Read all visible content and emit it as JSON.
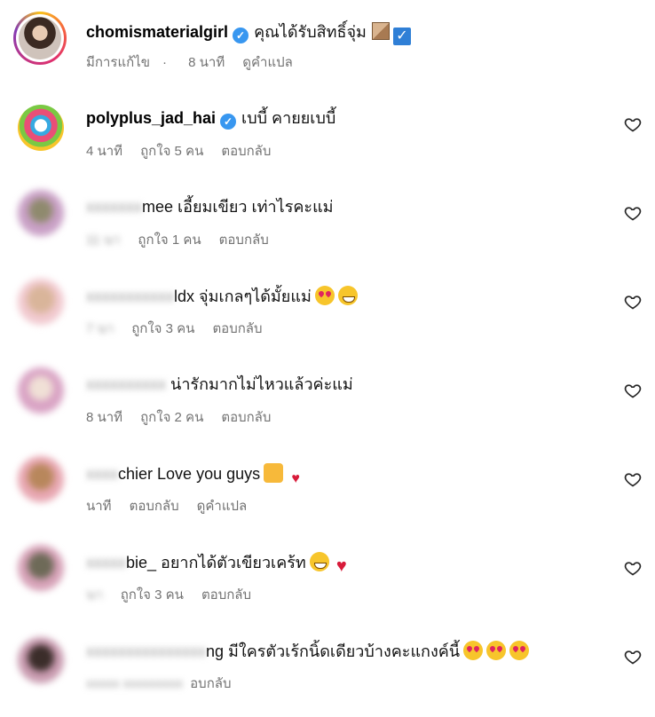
{
  "post": {
    "username": "chomismaterialgirl",
    "caption": "คุณได้รับสิทธิ์จุ่ม",
    "edited": "มีการแก้ไข",
    "time": "8 นาที",
    "translate": "ดูคำแปล"
  },
  "comments": [
    {
      "user_prefix": "",
      "user_visible": "polyplus_jad_hai",
      "verified": true,
      "text": "เบบี้ คายยเบบี้",
      "time": "4 นาที",
      "likes": "ถูกใจ 5 คน",
      "reply": "ตอบกลับ"
    },
    {
      "user_prefix": "xxxxxxx",
      "user_visible": "mee",
      "text": "เอี้ยมเขียว เท่าไรคะแม่",
      "time": "11 นา",
      "likes": "ถูกใจ 1 คน",
      "reply": "ตอบกลับ"
    },
    {
      "user_prefix": "xxxxxxxxxxx",
      "user_visible": "ldx",
      "text": "จุ่มเกลๆได้มั้ยแม่",
      "time": "7 นา",
      "likes": "ถูกใจ 3 คน",
      "reply": "ตอบกลับ"
    },
    {
      "user_prefix": "xxxxxxxxxx",
      "user_visible": "",
      "text": "น่ารักมากไม่ไหวแล้วค่ะแม่",
      "time": "8 นาที",
      "likes": "ถูกใจ 2 คน",
      "reply": "ตอบกลับ"
    },
    {
      "user_prefix": "xxxx",
      "user_visible": "chier",
      "text": "Love you guys",
      "time": "นาที",
      "likes": "",
      "reply": "ตอบกลับ",
      "translate": "ดูคำแปล"
    },
    {
      "user_prefix": "xxxxx",
      "user_visible": "bie_",
      "text": "อยากได้ตัวเขียวเคร้ท",
      "time": "นา",
      "likes": "ถูกใจ 3 คน",
      "reply": "ตอบกลับ"
    },
    {
      "user_prefix": "xxxxxxxxxxxxxxx",
      "user_visible": "ng",
      "text": "มีใครตัวเร้กนิ้ดเดียวบ้างคะแกงค์นี้",
      "time": "",
      "likes": "",
      "reply": "อบกลับ"
    }
  ],
  "icons": {
    "heart": "heart-outline-icon",
    "verified": "verified-badge-icon"
  },
  "colors": {
    "meta": "#737373",
    "verified": "#3897f0"
  }
}
